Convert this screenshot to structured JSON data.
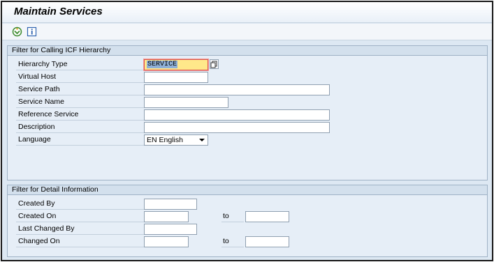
{
  "window": {
    "title": "Maintain Services"
  },
  "toolbar": {
    "execute_icon": "execute-icon",
    "info_icon": "info-icon"
  },
  "filter_hierarchy": {
    "header": "Filter for Calling ICF Hierarchy",
    "fields": {
      "hierarchy_type": {
        "label": "Hierarchy Type",
        "value": "SERVICE"
      },
      "virtual_host": {
        "label": "Virtual Host",
        "value": ""
      },
      "service_path": {
        "label": "Service Path",
        "value": ""
      },
      "service_name": {
        "label": "Service Name",
        "value": ""
      },
      "reference_service": {
        "label": "Reference Service",
        "value": ""
      },
      "description": {
        "label": "Description",
        "value": ""
      },
      "language": {
        "label": "Language",
        "value": "EN English"
      }
    }
  },
  "filter_detail": {
    "header": "Filter for Detail Information",
    "fields": {
      "created_by": {
        "label": "Created By",
        "value": ""
      },
      "created_on": {
        "label": "Created On",
        "value": "",
        "to_label": "to",
        "to_value": ""
      },
      "last_changed_by": {
        "label": "Last Changed By",
        "value": ""
      },
      "changed_on": {
        "label": "Changed On",
        "value": "",
        "to_label": "to",
        "to_value": ""
      }
    }
  },
  "colors": {
    "background": "#dde8f3",
    "focus_field": "#ffe88a",
    "focus_border": "#d9534f",
    "group_header": "#d3e0ed"
  }
}
